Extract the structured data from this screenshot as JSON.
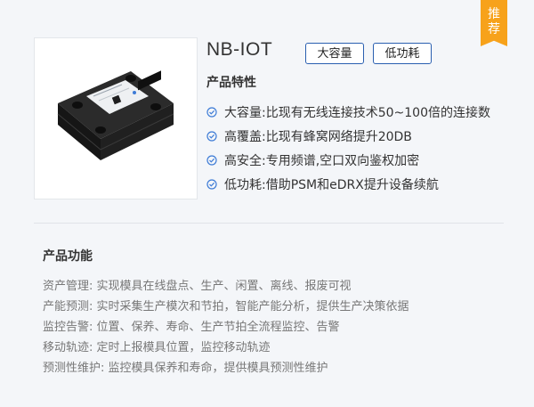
{
  "ribbon": {
    "chars": [
      "推",
      "荐"
    ]
  },
  "product": {
    "title": "NB-IOT",
    "tags": [
      "大容量",
      "低功耗"
    ]
  },
  "features": {
    "heading": "产品特性",
    "items": [
      "大容量:比现有无线连接技术50~100倍的连接数",
      "高覆盖:比现有蜂窝网络提升20DB",
      "高安全:专用频谱,空口双向鉴权加密",
      "低功耗:借助PSM和eDRX提升设备续航"
    ]
  },
  "functions": {
    "heading": "产品功能",
    "items": [
      "资产管理: 实现模具在线盘点、生产、闲置、离线、报废可视",
      "产能预测: 实时采集生产模次和节拍，智能产能分析，提供生产决策依据",
      "监控告警: 位置、保养、寿命、生产节拍全流程监控、告警",
      "移动轨迹: 定时上报模具位置，监控移动轨迹",
      "预测性维护: 监控模具保养和寿命，提供模具预测性维护"
    ]
  },
  "colors": {
    "ribbon": "#f7a21b",
    "tag_border": "#2a5fb0",
    "check": "#3d7bd6"
  }
}
